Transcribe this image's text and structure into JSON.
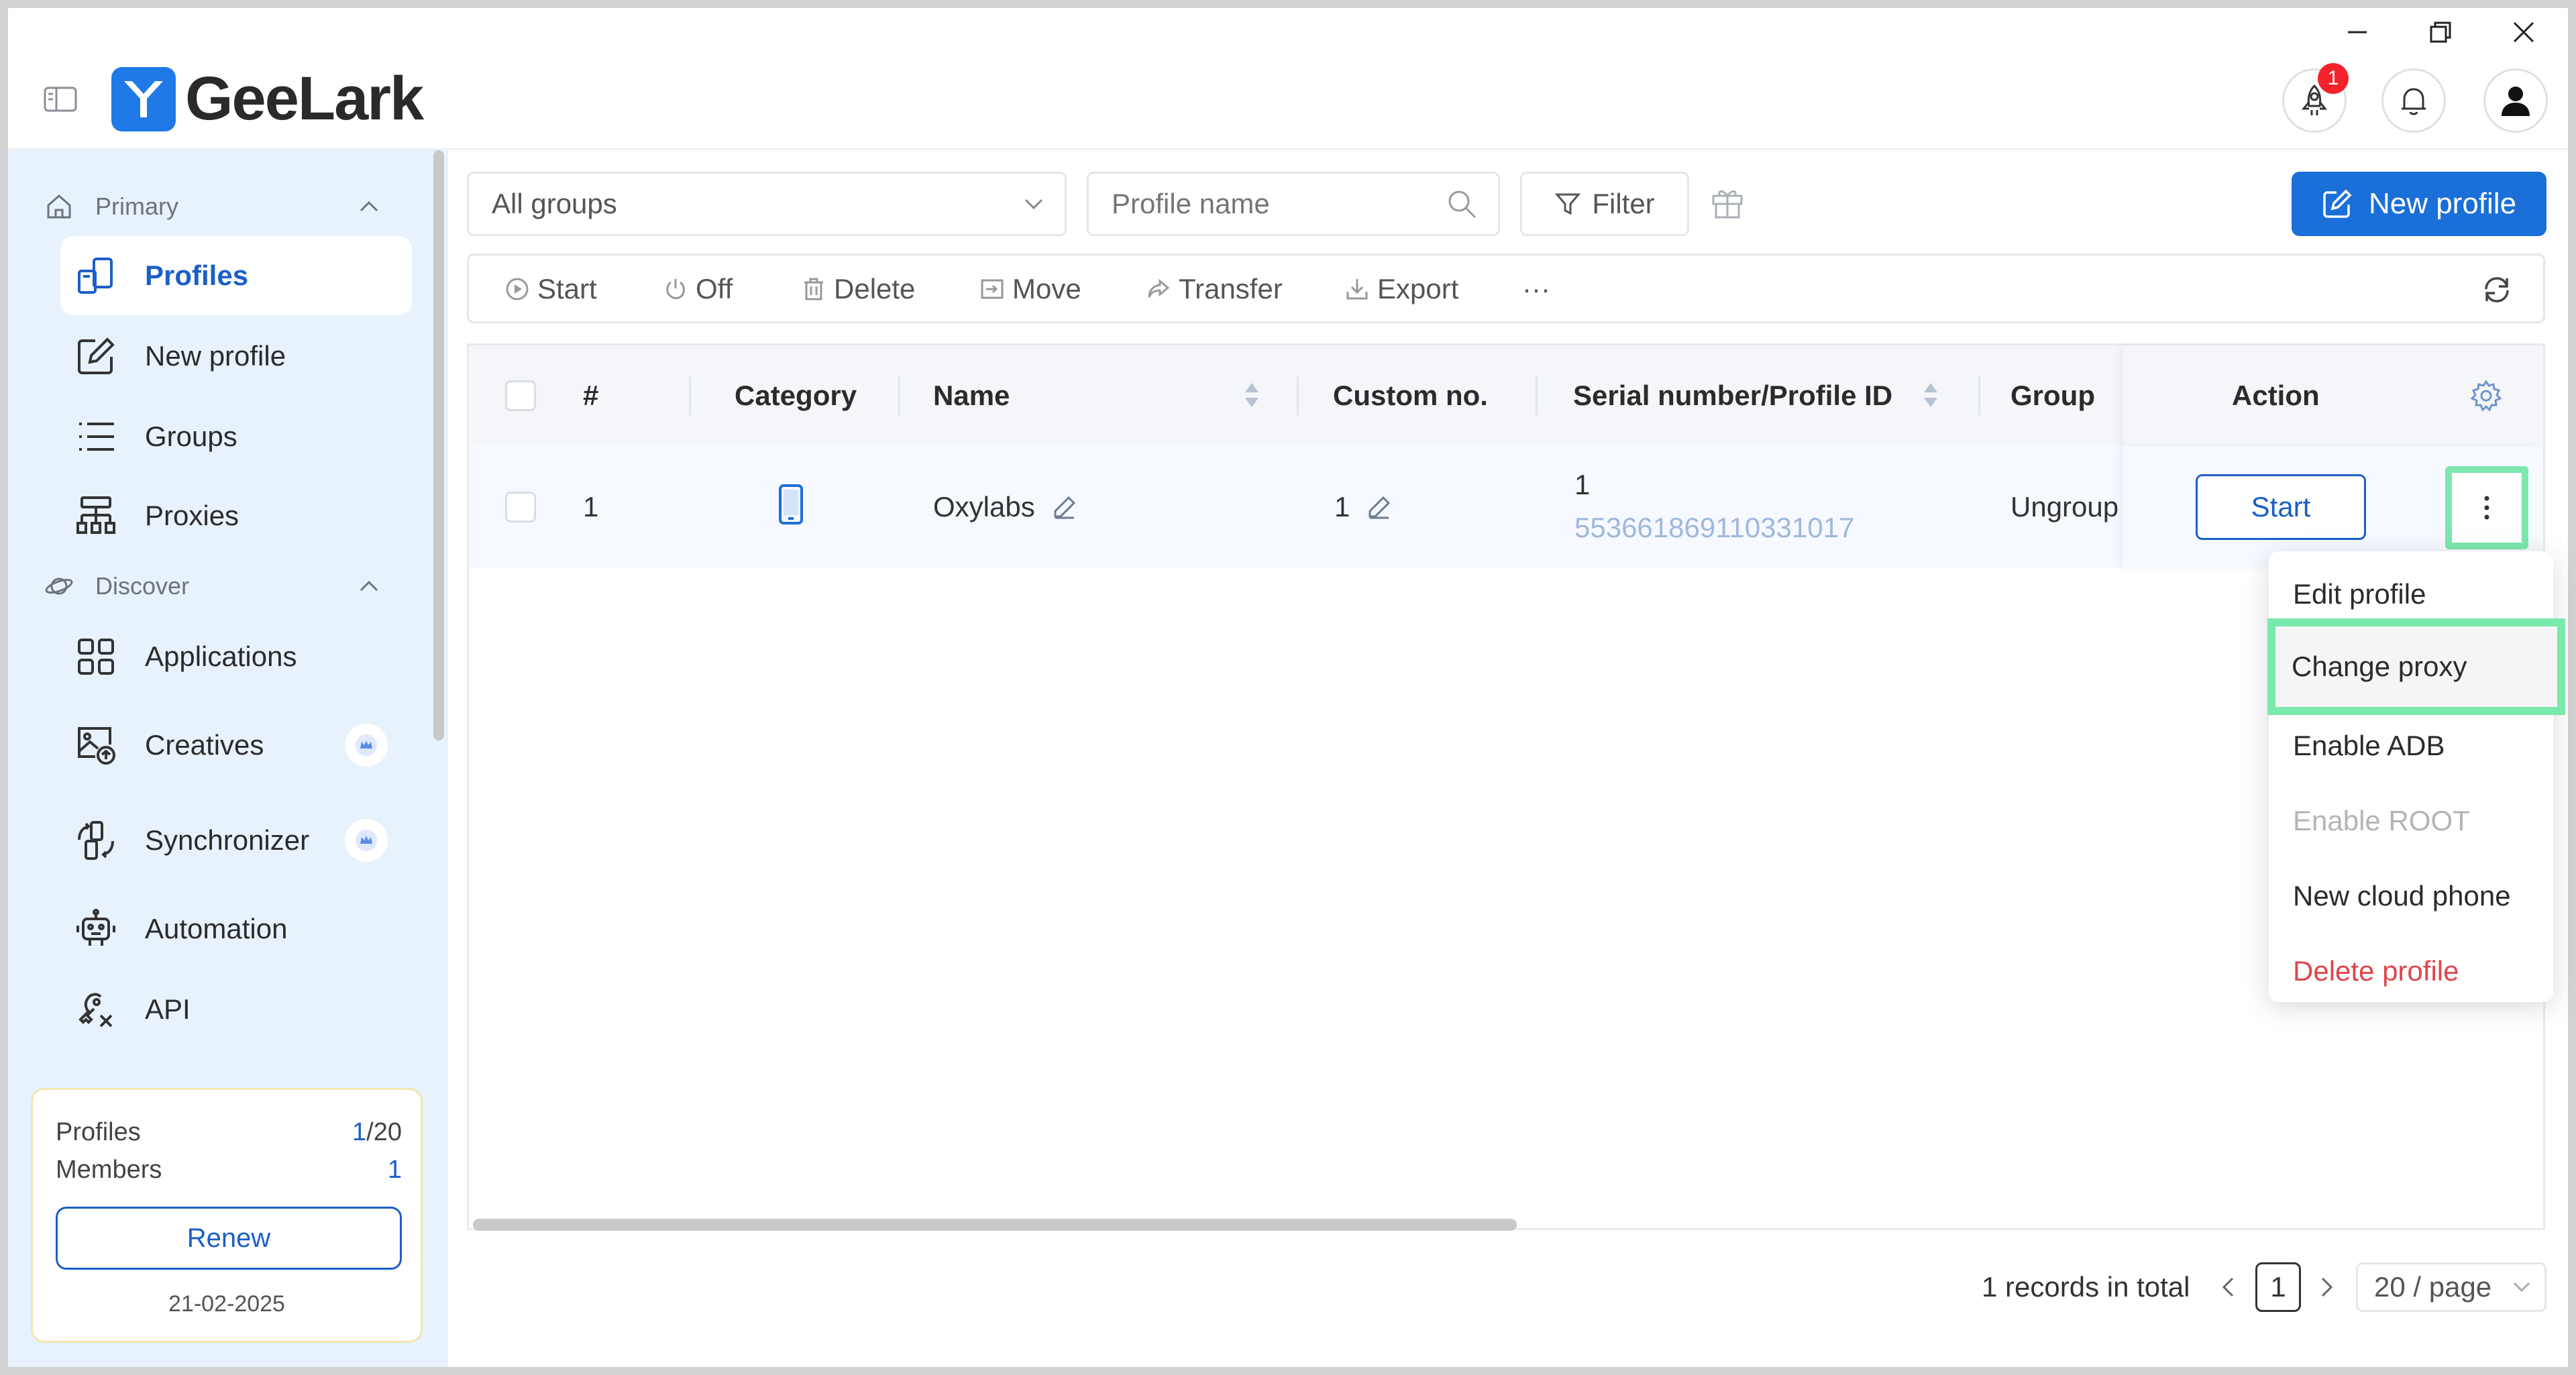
{
  "window": {
    "app_name": "GeeLark",
    "notification_badge": "1"
  },
  "sidebar": {
    "section_primary": "Primary",
    "section_discover": "Discover",
    "items": [
      {
        "label": "Profiles"
      },
      {
        "label": "New profile"
      },
      {
        "label": "Groups"
      },
      {
        "label": "Proxies"
      },
      {
        "label": "Applications"
      },
      {
        "label": "Creatives"
      },
      {
        "label": "Synchronizer"
      },
      {
        "label": "Automation"
      },
      {
        "label": "API"
      }
    ],
    "plan": {
      "profiles_label": "Profiles",
      "profiles_used": "1",
      "profiles_total": "/20",
      "members_label": "Members",
      "members_value": "1",
      "renew_label": "Renew",
      "date": "21-02-2025"
    }
  },
  "filters": {
    "group_select": "All groups",
    "search_placeholder": "Profile name",
    "filter_label": "Filter",
    "new_profile_label": "New profile"
  },
  "toolbar": {
    "start": "Start",
    "off": "Off",
    "delete": "Delete",
    "move": "Move",
    "transfer": "Transfer",
    "export": "Export",
    "more": "···"
  },
  "table": {
    "headers": {
      "index": "#",
      "category": "Category",
      "name": "Name",
      "custom_no": "Custom no.",
      "serial": "Serial number/Profile ID",
      "group": "Group",
      "action": "Action"
    },
    "rows": [
      {
        "index": "1",
        "category_icon": "phone-icon",
        "name": "Oxylabs",
        "custom_no": "1",
        "serial_number": "1",
        "profile_id": "553661869110331017",
        "group": "Ungroup",
        "action_label": "Start"
      }
    ]
  },
  "dropdown": {
    "items": [
      {
        "label": "Edit profile"
      },
      {
        "label": "Change proxy"
      },
      {
        "label": "Enable ADB"
      },
      {
        "label": "Enable ROOT"
      },
      {
        "label": "New cloud phone"
      },
      {
        "label": "Delete profile"
      }
    ]
  },
  "pagination": {
    "total_text": "1 records in total",
    "current_page": "1",
    "page_size": "20 / page"
  },
  "colors": {
    "accent": "#1b6fd8",
    "highlight": "#7be8ad",
    "danger": "#e0454b",
    "sidebar_bg": "#e8f2fc"
  }
}
